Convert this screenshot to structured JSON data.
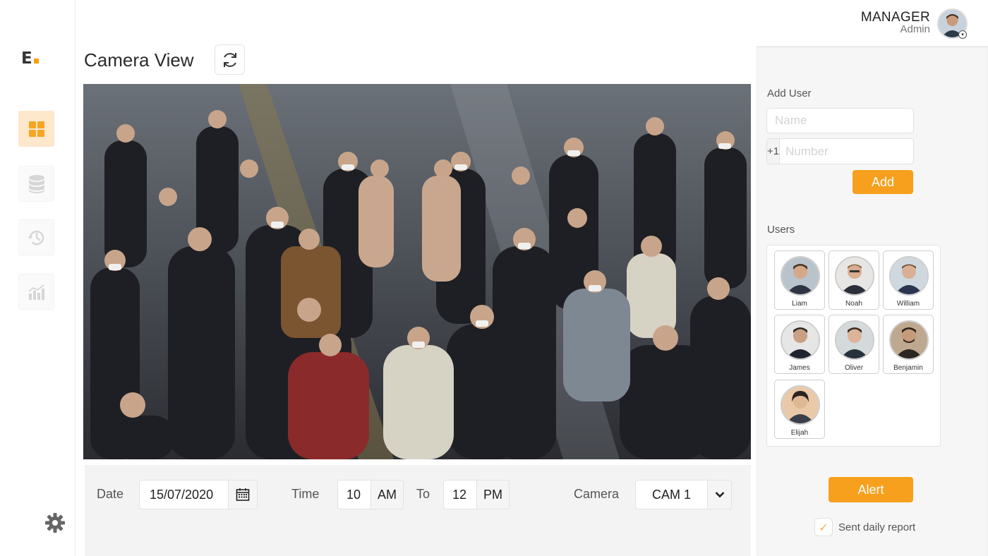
{
  "brand": {
    "logo_text": "E",
    "accent": "#f7a01e"
  },
  "sidebar": {
    "items": [
      {
        "name": "dashboard",
        "icon": "grid-icon",
        "active": true
      },
      {
        "name": "database",
        "icon": "database-icon",
        "active": false
      },
      {
        "name": "history",
        "icon": "history-icon",
        "active": false
      },
      {
        "name": "analytics",
        "icon": "bar-chart-icon",
        "active": false
      }
    ],
    "settings_icon": "gear-icon"
  },
  "header": {
    "title": "Camera View",
    "refresh_icon": "refresh-icon"
  },
  "user": {
    "role": "MANAGER",
    "name": "Admin"
  },
  "filters": {
    "date_label": "Date",
    "date_value": "15/07/2020",
    "time_label": "Time",
    "time_from": "10",
    "time_from_period": "AM",
    "to_label": "To",
    "time_to": "12",
    "time_to_period": "PM",
    "camera_label": "Camera",
    "camera_value": "CAM 1"
  },
  "add_user": {
    "title": "Add User",
    "name_placeholder": "Name",
    "phone_prefix": "+1",
    "number_placeholder": "Number",
    "add_label": "Add"
  },
  "users": {
    "title": "Users",
    "list": [
      {
        "name": "Liam"
      },
      {
        "name": "Noah"
      },
      {
        "name": "William"
      },
      {
        "name": "James"
      },
      {
        "name": "Oliver"
      },
      {
        "name": "Benjamin"
      },
      {
        "name": "Elijah"
      }
    ]
  },
  "alert_label": "Alert",
  "daily_report": {
    "label": "Sent daily report",
    "checked": true
  }
}
